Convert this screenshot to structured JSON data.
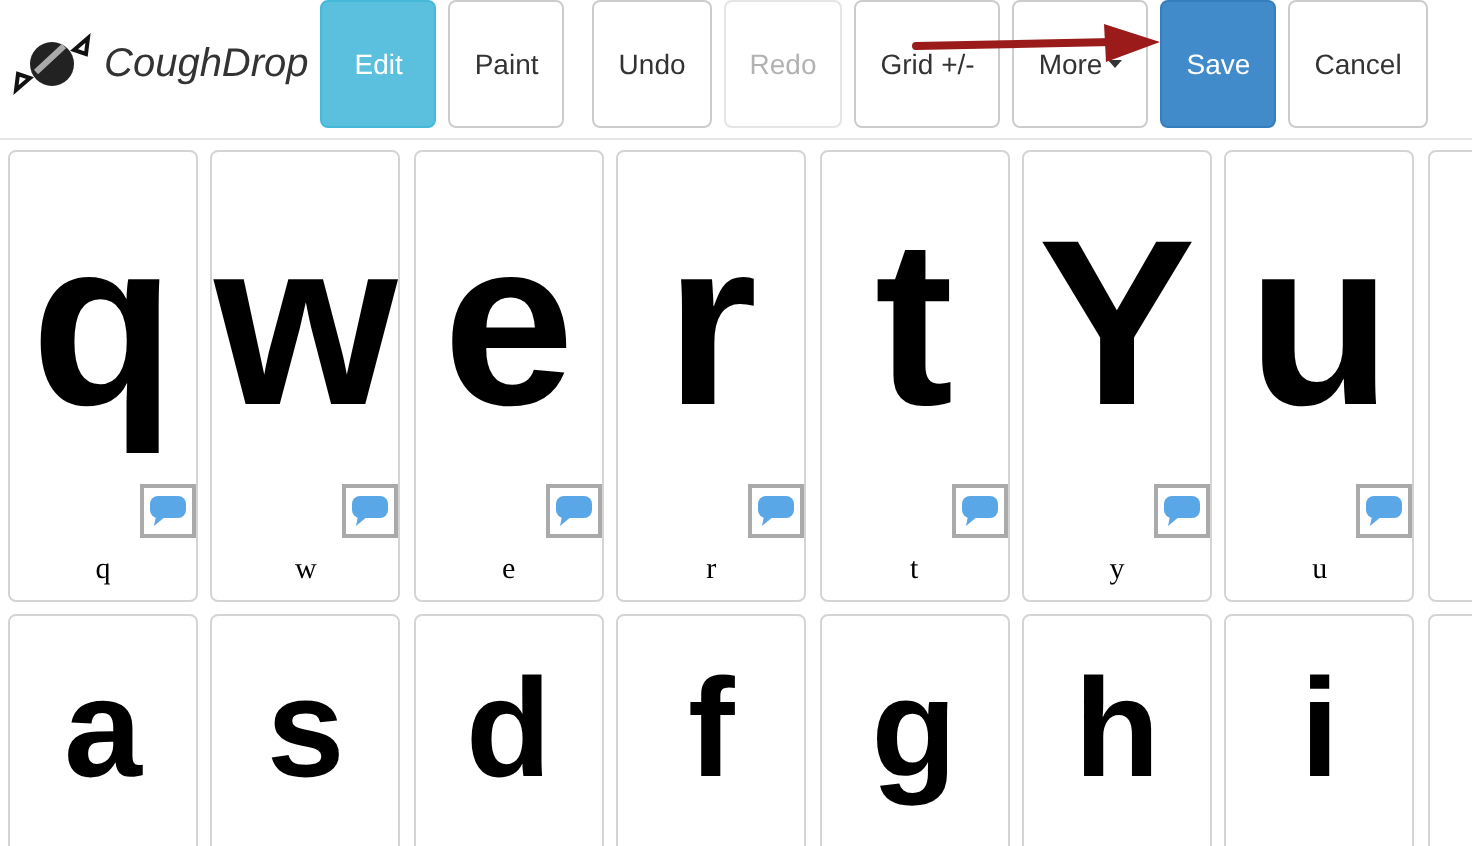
{
  "app": {
    "name": "CoughDrop"
  },
  "mode_buttons": [
    {
      "label": "Edit",
      "selected": true
    },
    {
      "label": "Paint",
      "selected": false
    }
  ],
  "actions": [
    {
      "label": "Undo",
      "kind": "plain",
      "disabled": false
    },
    {
      "label": "Redo",
      "kind": "plain",
      "disabled": true
    },
    {
      "label": "Grid +/-",
      "kind": "plain",
      "disabled": false
    },
    {
      "label": "More",
      "kind": "dropdown",
      "disabled": false
    },
    {
      "label": "Save",
      "kind": "primary",
      "disabled": false
    },
    {
      "label": "Cancel",
      "kind": "plain",
      "disabled": false
    }
  ],
  "rows": [
    [
      {
        "symbol": "q",
        "label": "q",
        "sound": true
      },
      {
        "symbol": "w",
        "label": "w",
        "sound": true
      },
      {
        "symbol": "e",
        "label": "e",
        "sound": true
      },
      {
        "symbol": "r",
        "label": "r",
        "sound": true
      },
      {
        "symbol": "t",
        "label": "t",
        "sound": true
      },
      {
        "symbol": "Y",
        "label": "y",
        "sound": true
      },
      {
        "symbol": "u",
        "label": "u",
        "sound": true
      }
    ],
    [
      {
        "symbol": "a"
      },
      {
        "symbol": "s"
      },
      {
        "symbol": "d"
      },
      {
        "symbol": "f"
      },
      {
        "symbol": "g"
      },
      {
        "symbol": "h"
      },
      {
        "symbol": "i"
      }
    ]
  ]
}
